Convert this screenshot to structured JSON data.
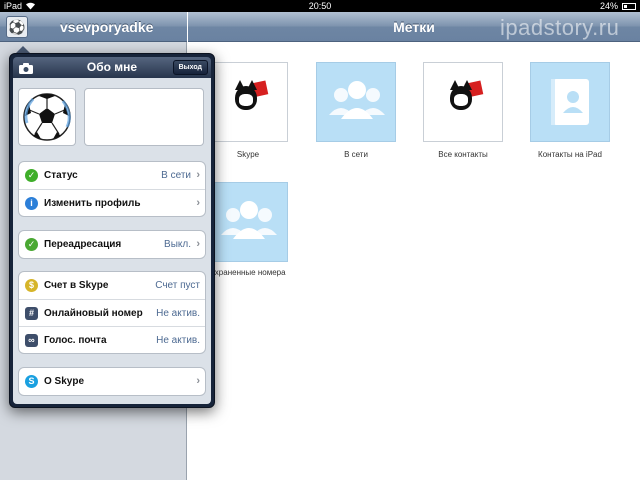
{
  "status_bar": {
    "device": "iPad",
    "time": "20:50",
    "battery": "24%"
  },
  "left": {
    "username": "vsevporyadke"
  },
  "right": {
    "title": "Метки",
    "watermark": "ipadstory.ru",
    "tiles": [
      {
        "label": "Skype",
        "icon": "felix-cat-avatar"
      },
      {
        "label": "В сети",
        "icon": "people-group-icon"
      },
      {
        "label": "Все контакты",
        "icon": "felix-cat-avatar"
      },
      {
        "label": "Контакты на iPad",
        "icon": "address-book-icon"
      },
      {
        "label": "охраненные номера",
        "icon": "people-group-icon"
      }
    ]
  },
  "popover": {
    "title": "Обо мне",
    "exit_label": "Выход",
    "groups": [
      [
        {
          "label": "Статус",
          "value": "В сети",
          "icon": "status-online-icon",
          "color": "#3fae2a",
          "arrow": true
        },
        {
          "label": "Изменить профиль",
          "value": "",
          "icon": "info-icon",
          "color": "#2c7fd8",
          "arrow": true
        }
      ],
      [
        {
          "label": "Переадресация",
          "value": "Выкл.",
          "icon": "forwarding-check-icon",
          "color": "#4aa833",
          "arrow": true
        }
      ],
      [
        {
          "label": "Счет в Skype",
          "value": "Счет пуст",
          "icon": "skype-credit-icon",
          "color": "#d6b52a",
          "arrow": false
        },
        {
          "label": "Онлайновый номер",
          "value": "Не актив.",
          "icon": "online-number-icon",
          "color": "#3e4e6a",
          "arrow": false
        },
        {
          "label": "Голос. почта",
          "value": "Не актив.",
          "icon": "voicemail-icon",
          "color": "#3e4e6a",
          "arrow": false
        }
      ],
      [
        {
          "label": "О Skype",
          "value": "",
          "icon": "skype-logo-icon",
          "color": "#1aa0e0",
          "arrow": true
        }
      ]
    ]
  }
}
